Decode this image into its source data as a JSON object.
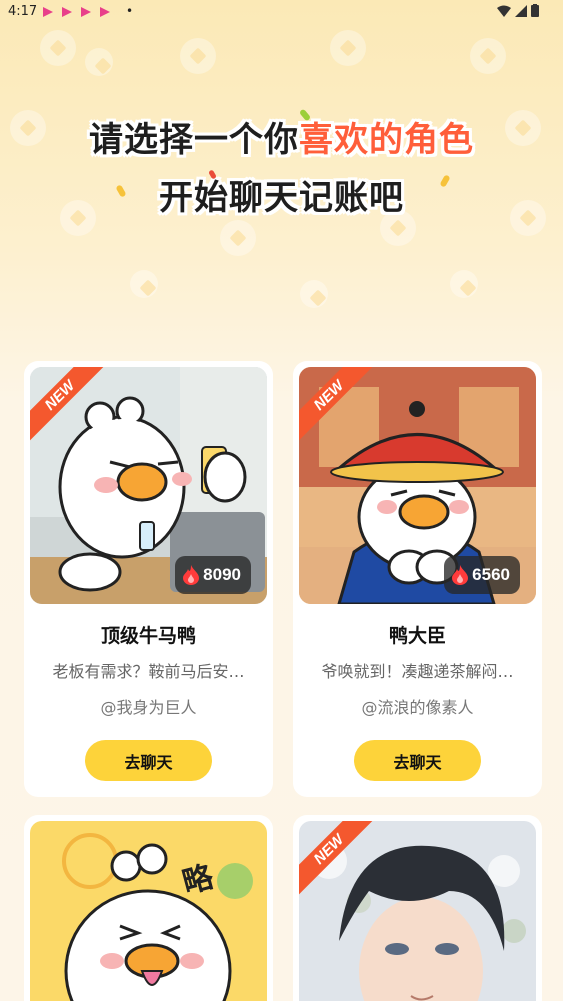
{
  "status_bar": {
    "time": "4:17",
    "dot": "•"
  },
  "headline": {
    "line1_plain": "请选择一个你",
    "line1_highlight": "喜欢的角色",
    "line2": "开始聊天记账吧"
  },
  "badges": {
    "new_label": "NEW"
  },
  "cards": [
    {
      "name": "顶级牛马鸭",
      "description": "老板有需求？鞍前马后安…",
      "author": "@我身为巨人",
      "heat": "8090",
      "button": "去聊天"
    },
    {
      "name": "鸭大臣",
      "description": "爷唤就到！凑趣递茶解闷…",
      "author": "@流浪的像素人",
      "heat": "6560",
      "button": "去聊天"
    },
    {
      "art_text": "略"
    },
    {}
  ],
  "colors": {
    "accent": "#fdd33a",
    "highlight": "#ff5e3a",
    "new_tag": "#f4582e"
  }
}
